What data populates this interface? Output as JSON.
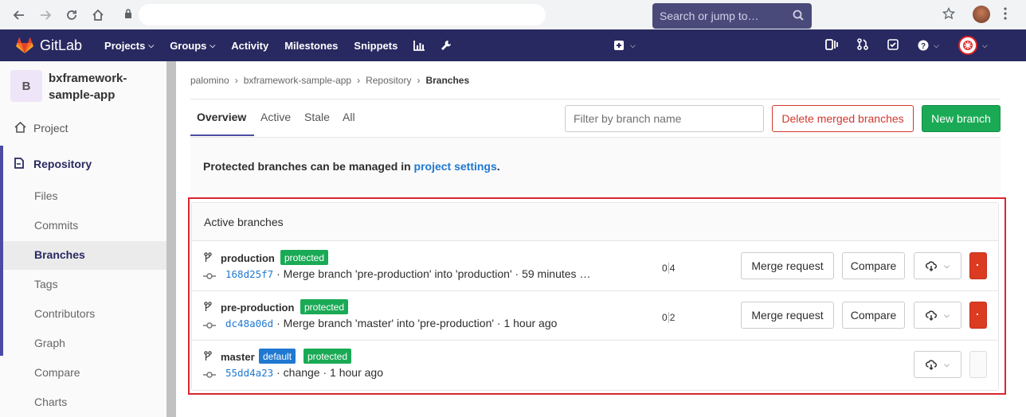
{
  "browser": {
    "url": ""
  },
  "navbar": {
    "brand": "GitLab",
    "links": [
      {
        "label": "Projects",
        "dropdown": true
      },
      {
        "label": "Groups",
        "dropdown": true
      },
      {
        "label": "Activity",
        "dropdown": false
      },
      {
        "label": "Milestones",
        "dropdown": false
      },
      {
        "label": "Snippets",
        "dropdown": false
      }
    ],
    "search_placeholder": "Search or jump to…",
    "accent": "#292961"
  },
  "sidebar": {
    "avatar_letter": "B",
    "project_name": "bxframework-sample-app",
    "project_label": "Project",
    "repository_label": "Repository",
    "sub_items": [
      "Files",
      "Commits",
      "Branches",
      "Tags",
      "Contributors",
      "Graph",
      "Compare",
      "Charts"
    ]
  },
  "breadcrumb": {
    "items": [
      "palomino",
      "bxframework-sample-app",
      "Repository"
    ],
    "current": "Branches"
  },
  "tabs": [
    "Overview",
    "Active",
    "Stale",
    "All"
  ],
  "filter_placeholder": "Filter by branch name",
  "buttons": {
    "delete_merged": "Delete merged branches",
    "new_branch": "New branch"
  },
  "notice": {
    "text": "Protected branches can be managed in ",
    "link": "project settings",
    "end": "."
  },
  "panel": {
    "title": "Active branches",
    "branches": [
      {
        "name": "production",
        "badges": [
          "protected"
        ],
        "sha": "168d25f7",
        "message": " · Merge branch 'pre-production' into 'production' · 59 minutes …",
        "behind": "0",
        "ahead": "4",
        "merge_request": "Merge request",
        "compare": "Compare"
      },
      {
        "name": "pre-production",
        "badges": [
          "protected"
        ],
        "sha": "dc48a06d",
        "message": " · Merge branch 'master' into 'pre-production' · 1 hour ago",
        "behind": "0",
        "ahead": "2",
        "merge_request": "Merge request",
        "compare": "Compare"
      },
      {
        "name": "master",
        "badges": [
          "default",
          "protected"
        ],
        "sha": "55dd4a23",
        "message": " · change · 1 hour ago"
      }
    ]
  },
  "colors": {
    "green": "#1aaa55",
    "blue": "#1f78d1",
    "danger": "#db3b21",
    "highlight": "#d9262f"
  }
}
